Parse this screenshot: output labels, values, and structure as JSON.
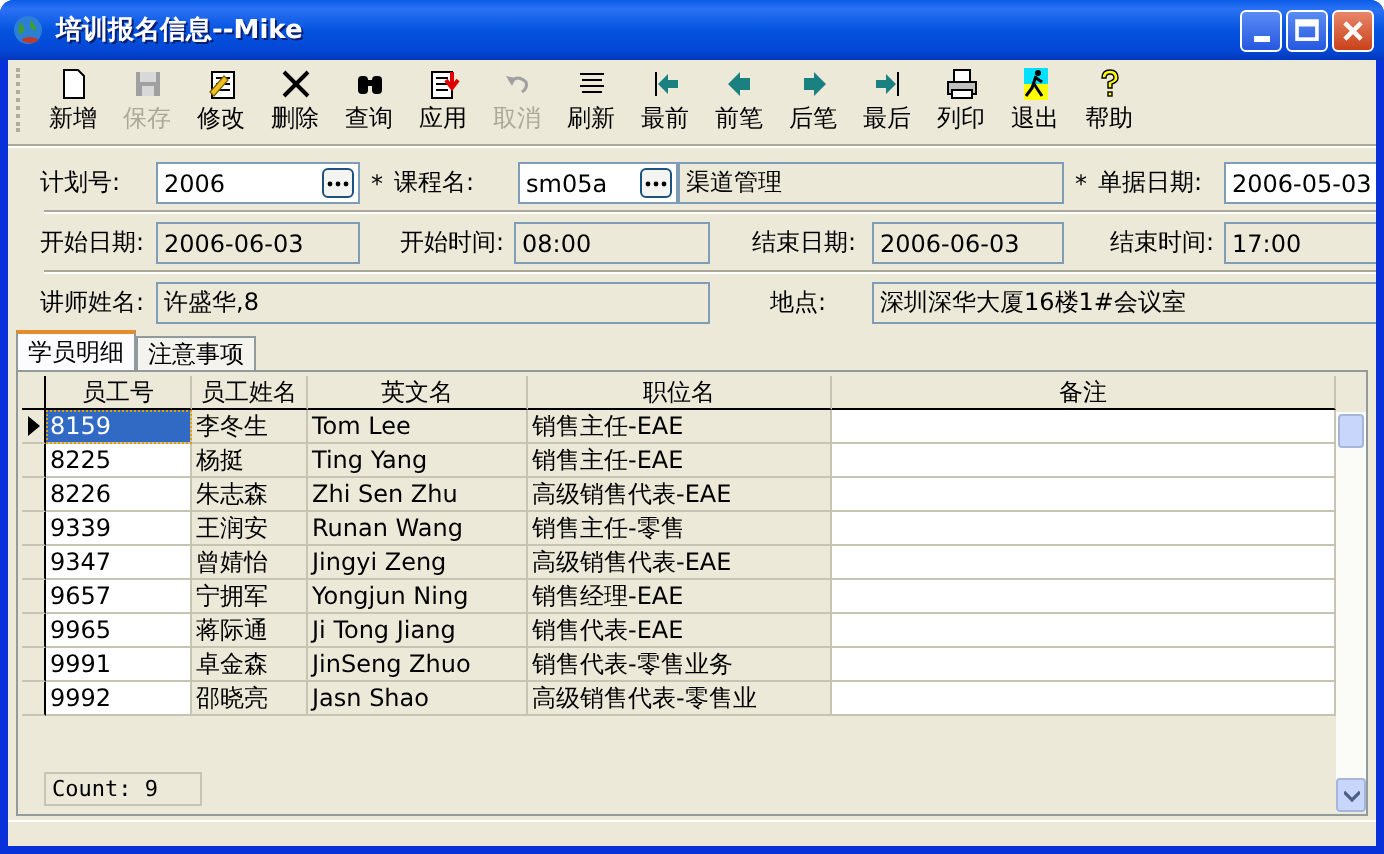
{
  "window": {
    "title": "培训报名信息--Mike"
  },
  "toolbar": [
    {
      "kind": "new",
      "label": "新增",
      "disabled": false
    },
    {
      "kind": "save",
      "label": "保存",
      "disabled": true
    },
    {
      "kind": "edit",
      "label": "修改",
      "disabled": false
    },
    {
      "kind": "delete",
      "label": "删除",
      "disabled": false
    },
    {
      "kind": "find",
      "label": "查询",
      "disabled": false
    },
    {
      "kind": "apply",
      "label": "应用",
      "disabled": false
    },
    {
      "kind": "undo",
      "label": "取消",
      "disabled": true
    },
    {
      "kind": "refresh",
      "label": "刷新",
      "disabled": false
    },
    {
      "kind": "first",
      "label": "最前",
      "disabled": false
    },
    {
      "kind": "prev",
      "label": "前笔",
      "disabled": false
    },
    {
      "kind": "next",
      "label": "后笔",
      "disabled": false
    },
    {
      "kind": "last",
      "label": "最后",
      "disabled": false
    },
    {
      "kind": "print",
      "label": "列印",
      "disabled": false
    },
    {
      "kind": "exit",
      "label": "退出",
      "disabled": false
    },
    {
      "kind": "help",
      "label": "帮助",
      "disabled": false
    }
  ],
  "form": {
    "rows": [
      {
        "items": [
          {
            "kind": "label",
            "text": "计划号:"
          },
          {
            "kind": "lookup",
            "value": "2006"
          },
          {
            "kind": "required",
            "text": "*"
          },
          {
            "kind": "label",
            "text": "课程名:"
          },
          {
            "kind": "lookup",
            "value": "sm05a"
          },
          {
            "kind": "readonly",
            "value": "渠道管理"
          },
          {
            "kind": "required",
            "text": "*"
          },
          {
            "kind": "label",
            "text": "单据日期:"
          },
          {
            "kind": "input",
            "value": "2006-05-03"
          }
        ]
      },
      {
        "items": [
          {
            "kind": "label",
            "text": "开始日期:"
          },
          {
            "kind": "readonly",
            "value": "2006-06-03"
          },
          {
            "kind": "label",
            "text": "开始时间:"
          },
          {
            "kind": "readonly",
            "value": "08:00"
          },
          {
            "kind": "label",
            "text": "结束日期:"
          },
          {
            "kind": "readonly",
            "value": "2006-06-03"
          },
          {
            "kind": "label",
            "text": "结束时间:"
          },
          {
            "kind": "readonly",
            "value": "17:00"
          }
        ]
      },
      {
        "items": [
          {
            "kind": "label",
            "text": "讲师姓名:"
          },
          {
            "kind": "readonly",
            "value": "许盛华,8"
          },
          {
            "kind": "label",
            "text": "地点:"
          },
          {
            "kind": "readonly",
            "value": "深圳深华大厦16楼1#会议室"
          }
        ]
      }
    ]
  },
  "tabs": [
    {
      "label": "学员明细",
      "selected": true
    },
    {
      "label": "注意事项",
      "selected": false
    }
  ],
  "table": {
    "columns": [
      {
        "label": "员工号",
        "editable": true
      },
      {
        "label": "员工姓名",
        "editable": false
      },
      {
        "label": "英文名",
        "editable": false
      },
      {
        "label": "职位名",
        "editable": false
      },
      {
        "label": "备注",
        "editable": true
      }
    ],
    "rows": [
      {
        "selected": true,
        "cells": [
          "8159",
          "李冬生",
          "Tom Lee",
          "销售主任-EAE"
        ]
      },
      {
        "selected": false,
        "cells": [
          "8225",
          "杨挺",
          "Ting Yang",
          "销售主任-EAE"
        ]
      },
      {
        "selected": false,
        "cells": [
          "8226",
          "朱志森",
          "Zhi Sen Zhu",
          "高级销售代表-EAE"
        ]
      },
      {
        "selected": false,
        "cells": [
          "9339",
          "王润安",
          "Runan Wang",
          "销售主任-零售"
        ]
      },
      {
        "selected": false,
        "cells": [
          "9347",
          "曾婧怡",
          "Jingyi Zeng",
          "高级销售代表-EAE"
        ]
      },
      {
        "selected": false,
        "cells": [
          "9657",
          "宁拥军",
          "Yongjun Ning",
          "销售经理-EAE"
        ]
      },
      {
        "selected": false,
        "cells": [
          "9965",
          "蒋际通",
          "Ji Tong Jiang",
          "销售代表-EAE"
        ]
      },
      {
        "selected": false,
        "cells": [
          "9991",
          "卓金森",
          "JinSeng Zhuo",
          "销售代表-零售业务"
        ]
      },
      {
        "selected": false,
        "cells": [
          "9992",
          "邵晓亮",
          "Jasn Shao",
          "高级销售代表-零售业"
        ]
      }
    ],
    "footer": "Count: 9"
  }
}
